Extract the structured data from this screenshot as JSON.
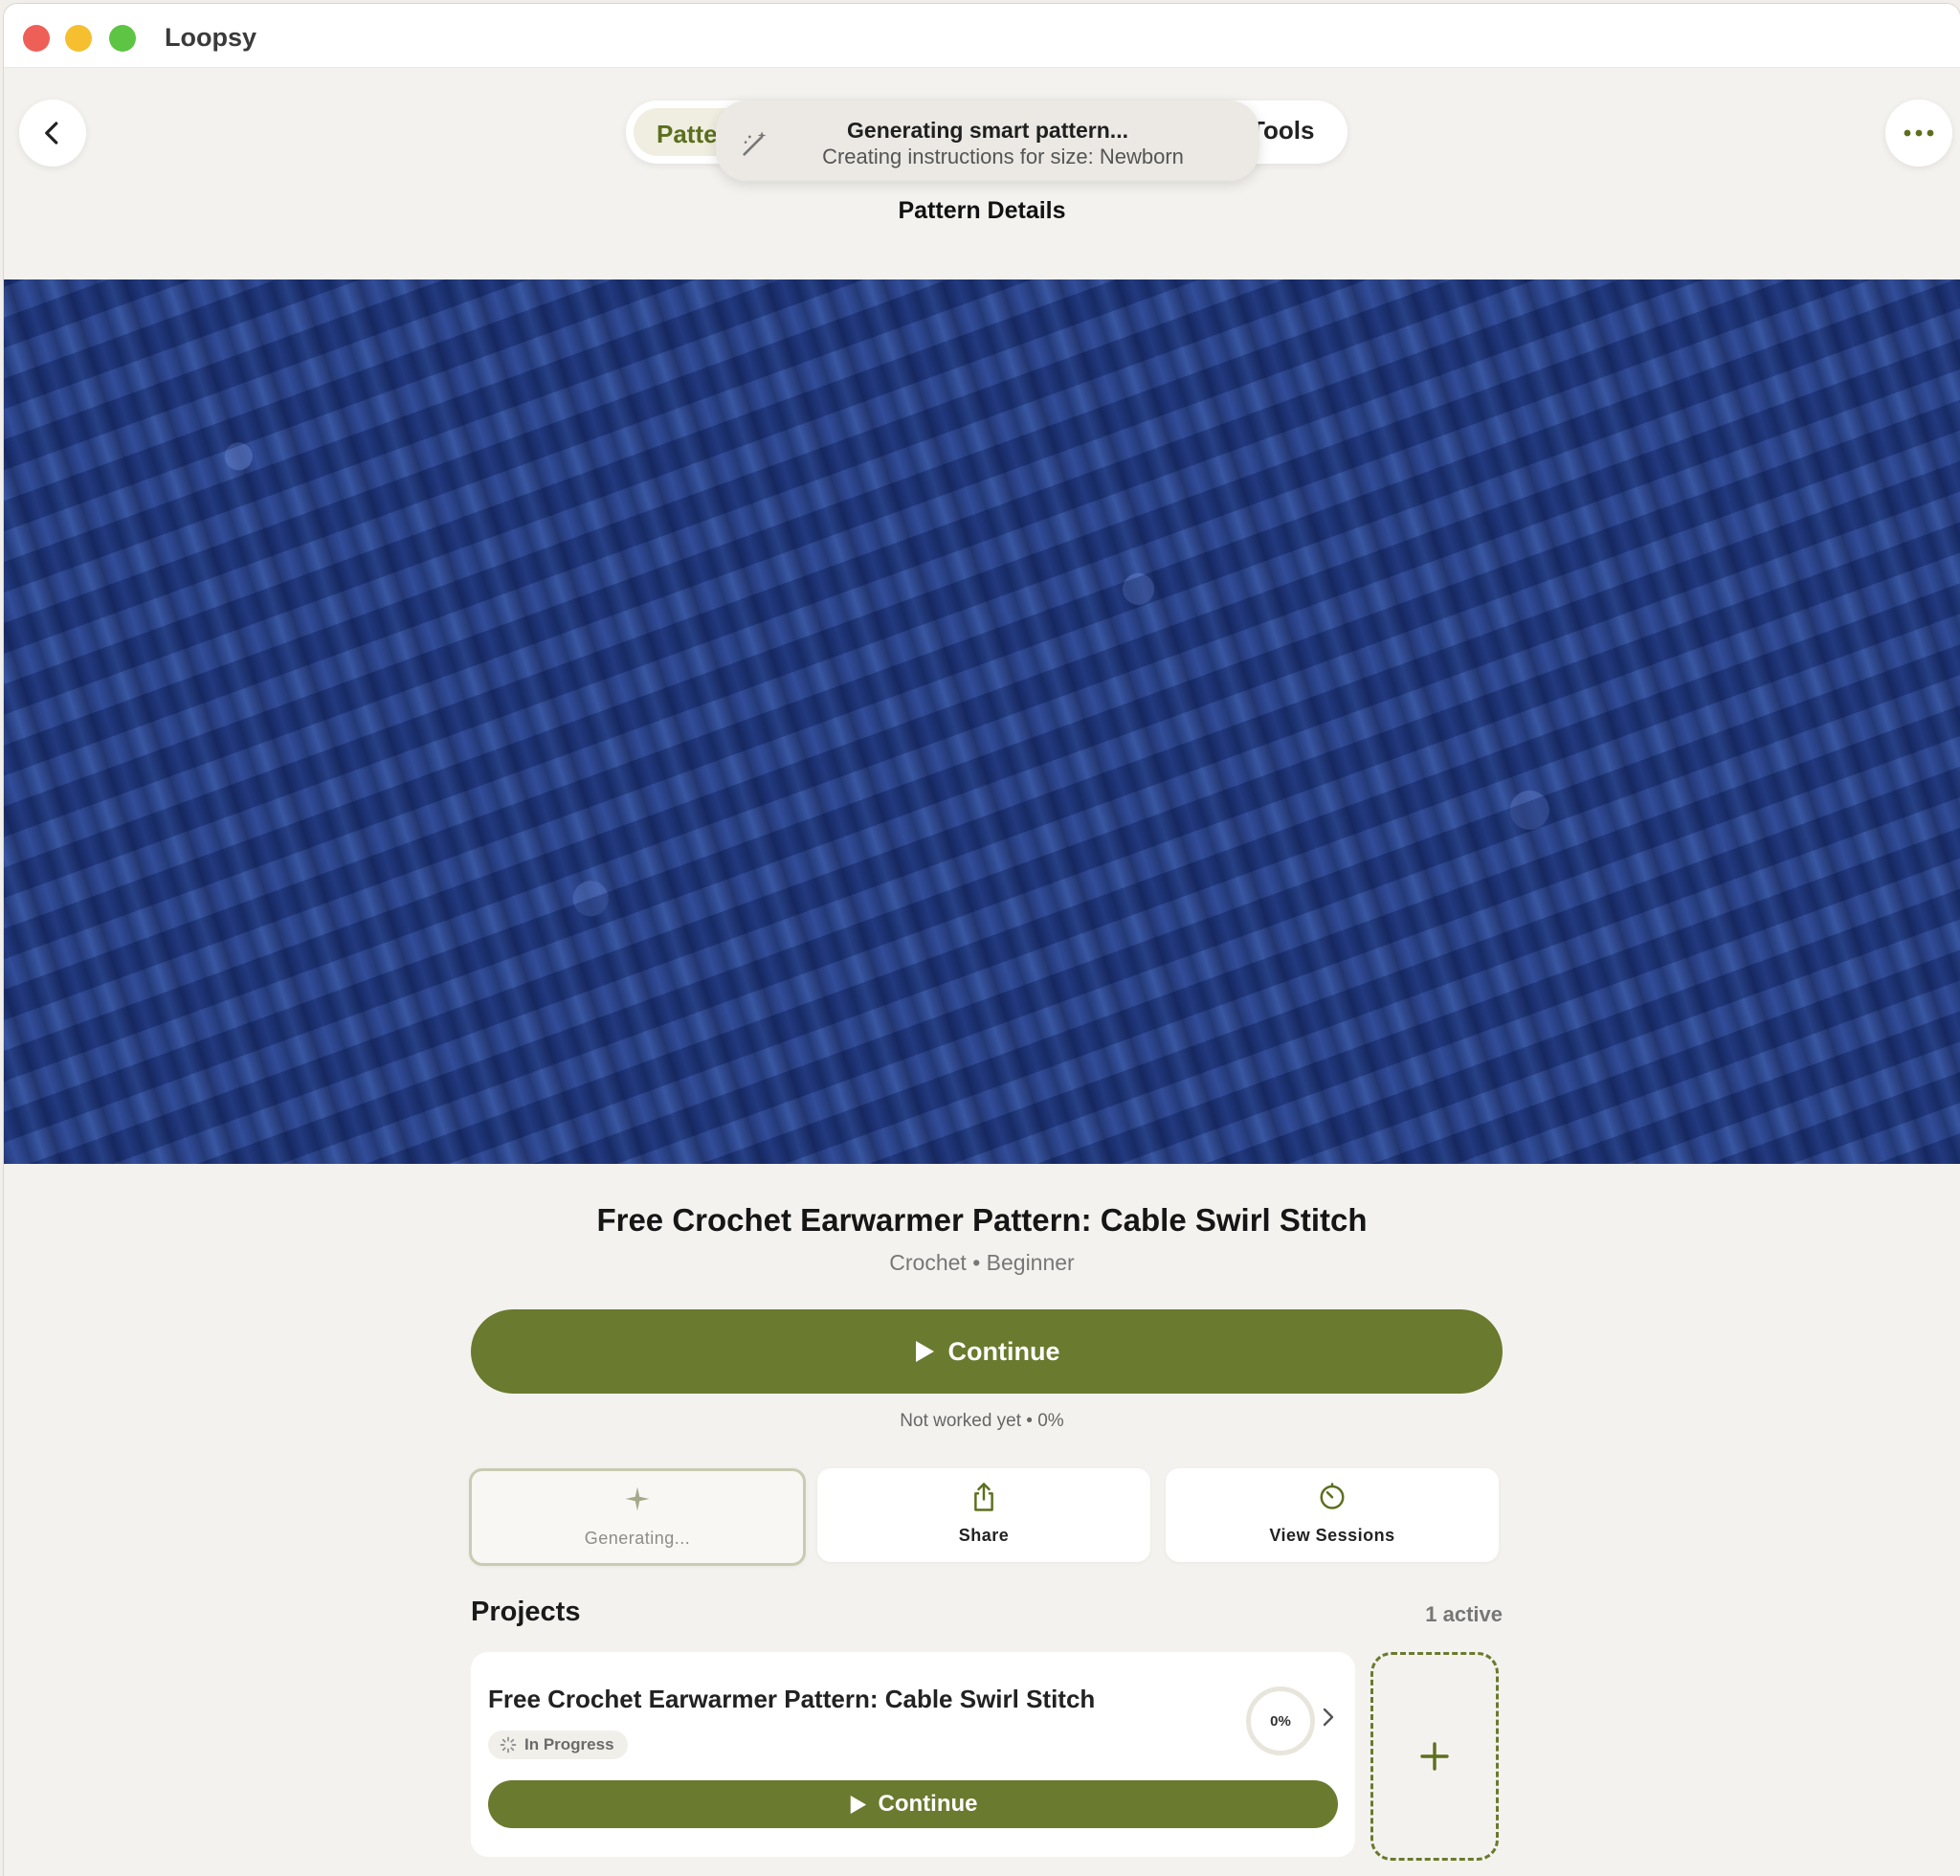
{
  "window": {
    "title": "Loopsy"
  },
  "header": {
    "tabs": [
      {
        "label": "Patte",
        "active": true
      },
      {
        "label": "Tools",
        "active": false
      }
    ],
    "page_title": "Pattern Details"
  },
  "toast": {
    "title": "Generating smart pattern...",
    "subtitle": "Creating instructions for size: Newborn",
    "icon": "magic-wand-icon"
  },
  "pattern": {
    "title": "Free Crochet Earwarmer Pattern: Cable Swirl Stitch",
    "meta": "Crochet • Beginner",
    "continue_label": "Continue",
    "progress_text": "Not worked yet • 0%",
    "progress_percent": 0
  },
  "actions": [
    {
      "label": "Generating...",
      "icon": "sparkle-icon"
    },
    {
      "label": "Share",
      "icon": "share-icon"
    },
    {
      "label": "View Sessions",
      "icon": "timer-icon"
    }
  ],
  "projects": {
    "heading": "Projects",
    "count_label": "1 active",
    "items": [
      {
        "title": "Free Crochet Earwarmer Pattern: Cable Swirl Stitch",
        "status": "In Progress",
        "progress_label": "0%",
        "continue_label": "Continue"
      }
    ]
  },
  "colors": {
    "accent": "#6a7a2e",
    "background": "#f4f2ee",
    "card": "#ffffff"
  }
}
